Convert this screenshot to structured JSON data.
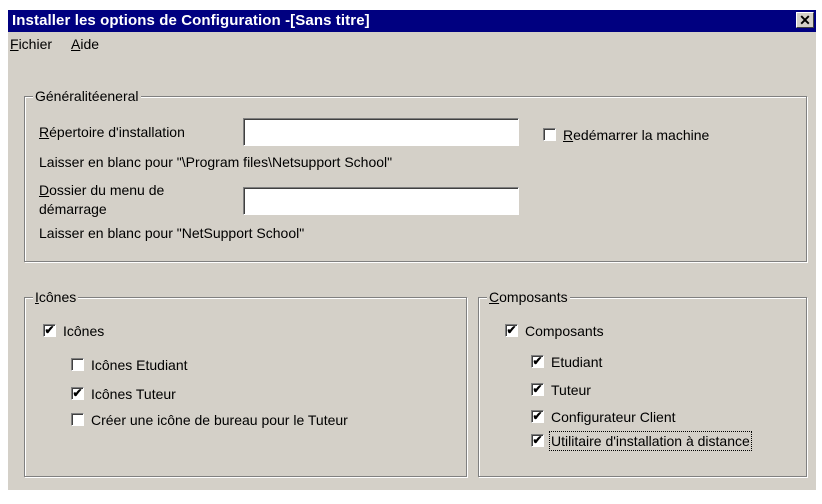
{
  "window": {
    "title": "Installer les options de Configuration -[Sans titre]",
    "close_glyph": "✕"
  },
  "menubar": {
    "items": [
      {
        "mnemonic": "F",
        "rest": "ichier"
      },
      {
        "mnemonic": "A",
        "rest": "ide"
      }
    ]
  },
  "general": {
    "legend": "Généralitéeneral",
    "install_dir_label_mn": "R",
    "install_dir_label_rest": "épertoire d'installation",
    "install_dir_value": "",
    "install_dir_hint": "Laisser en blanc pour \"\\Program files\\Netsupport School\"",
    "restart_mn": "R",
    "restart_rest": "edémarrer la machine",
    "restart_checked": false,
    "start_menu_label_mn": "D",
    "start_menu_label_rest1": "ossier du menu de",
    "start_menu_label_line2": "démarrage",
    "start_menu_value": "",
    "start_menu_hint": "Laisser en blanc pour \"NetSupport School\""
  },
  "icons_group": {
    "legend_mn": "I",
    "legend_rest": "cônes",
    "items": [
      {
        "label": "Icônes",
        "checked": true
      },
      {
        "label": "Icônes Etudiant",
        "checked": false
      },
      {
        "label": "Icônes Tuteur",
        "checked": true
      },
      {
        "label": "Créer une icône de bureau pour le Tuteur",
        "checked": false
      }
    ]
  },
  "components_group": {
    "legend_mn": "C",
    "legend_rest": "omposants",
    "items": [
      {
        "label": "Composants",
        "checked": true
      },
      {
        "label": "Etudiant",
        "checked": true
      },
      {
        "label": "Tuteur",
        "checked": true
      },
      {
        "label": "Configurateur Client",
        "checked": true
      },
      {
        "label": "Utilitaire d'installation à distance",
        "checked": true
      }
    ]
  },
  "check_glyph": "✔"
}
